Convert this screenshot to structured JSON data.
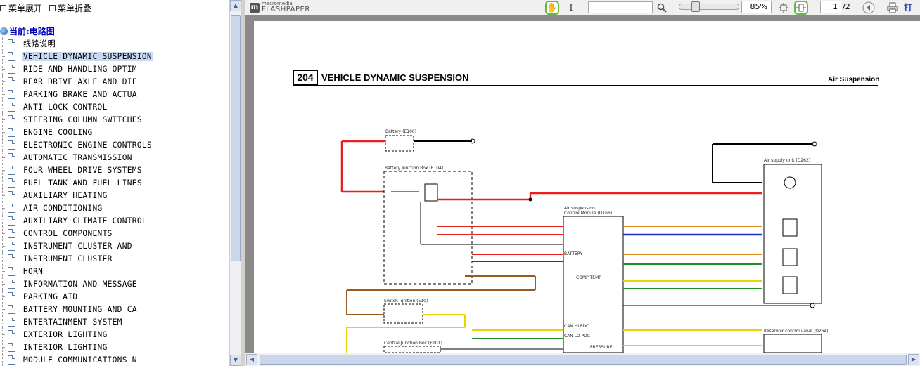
{
  "left_panel": {
    "expand_label": "菜单展开",
    "collapse_label": "菜单折叠",
    "root_label": "当前:电路图",
    "items": [
      "线路说明",
      "VEHICLE DYNAMIC SUSPENSION",
      "RIDE AND HANDLING OPTIM",
      "REAR DRIVE AXLE AND DIF",
      "PARKING BRAKE AND ACTUA",
      "ANTI—LOCK CONTROL",
      "STEERING COLUMN SWITCHES",
      "ENGINE COOLING",
      "ELECTRONIC ENGINE CONTROLS",
      "AUTOMATIC TRANSMISSION",
      "FOUR WHEEL DRIVE SYSTEMS",
      "FUEL TANK AND FUEL LINES",
      "AUXILIARY HEATING",
      "AIR CONDITIONING",
      "AUXILIARY CLIMATE CONTROL",
      "CONTROL COMPONENTS",
      "INSTRUMENT CLUSTER AND",
      "INSTRUMENT CLUSTER",
      "HORN",
      "INFORMATION AND MESSAGE",
      "PARKING AID",
      "BATTERY MOUNTING AND CA",
      "ENTERTAINMENT SYSTEM",
      "EXTERIOR LIGHTING",
      "INTERIOR LIGHTING",
      "MODULE COMMUNICATIONS N"
    ],
    "selected_index": 1
  },
  "toolbar": {
    "logo_top": "macromedia",
    "logo_bottom": "FLASHPAPER",
    "zoom": "85%",
    "page_current": "1",
    "page_total": "/2",
    "print_label": "打印",
    "icons": {
      "hand": "hand-tool-icon",
      "text": "text-select-icon",
      "search": "search-icon",
      "fit_page": "fit-page-icon",
      "fit_width": "fit-width-icon",
      "prev": "previous-page-icon",
      "print": "printer-icon"
    }
  },
  "document": {
    "page_number": "204",
    "title": "VEHICLE DYNAMIC SUSPENSION",
    "section": "Air Suspension",
    "labels": {
      "battery": "Battery (E100)",
      "bjb": "Battery Junction Box (E104)",
      "asm": "Air suspension",
      "asm2": "Control Module (D166)",
      "supply_unit": "Air supply unit (D262)",
      "switch_ignition": "Switch Ignition (S10)",
      "cjb": "Central Junction Box (E101)",
      "reservoir": "Reservoir control valve (D264)",
      "comp_temp": "COMP TEMP",
      "can_hi": "CAN HI PDC",
      "can_lo": "CAN LO PDC",
      "battery_pin": "BATTERY",
      "pressure": "PRESSURE"
    }
  },
  "colors": {
    "red": "#e8201e",
    "blue": "#1e2fd0",
    "yellow": "#e8d400",
    "brown": "#9a5a22",
    "green": "#1f8f1f",
    "orange": "#e08a1e",
    "selected": "#c8d8f0",
    "accent_green": "#62b844"
  }
}
